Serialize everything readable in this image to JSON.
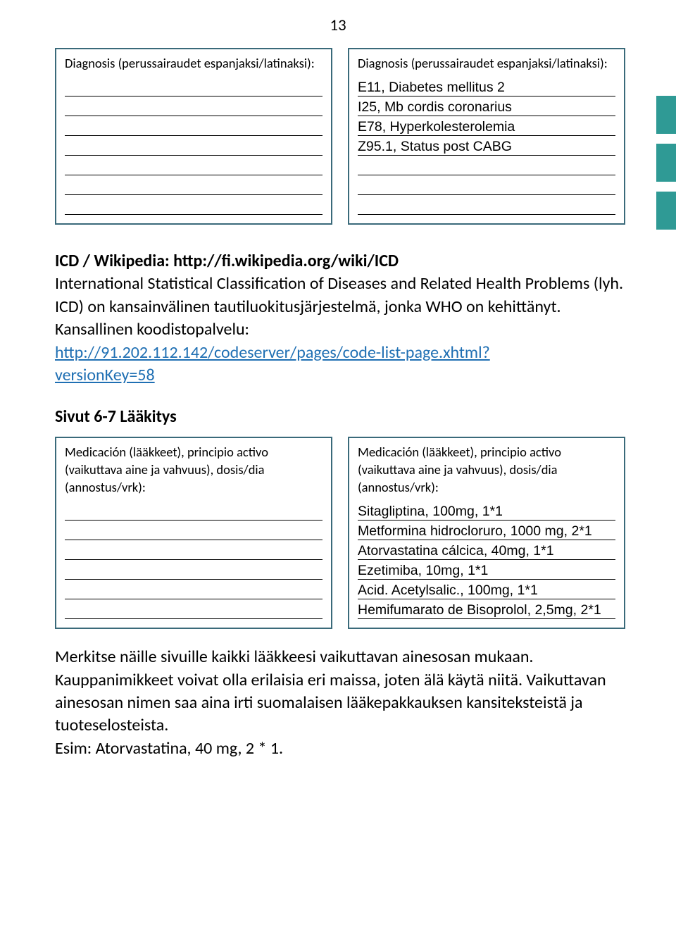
{
  "page_number": "13",
  "diag_box_left": {
    "label": "Diagnosis (perussairaudet espanjaksi/latinaksi):",
    "lines": [
      "",
      "",
      "",
      "",
      "",
      "",
      ""
    ]
  },
  "diag_box_right": {
    "label": "Diagnosis (perussairaudet espanjaksi/latinaksi):",
    "lines": [
      "E11, Diabetes mellitus 2",
      "I25, Mb cordis coronarius",
      "E78, Hyperkolesterolemia",
      "Z95.1, Status post CABG",
      "",
      "",
      ""
    ]
  },
  "icd_para": {
    "lead": "ICD / Wikipedia: http://fi.wikipedia.org/wiki/ICD",
    "text1": "International Statistical Classification of Diseases and Related Health Problems (lyh. ICD) on kansainvälinen tautiluokitusjärjestelmä, jonka WHO on kehittänyt.",
    "text2": "Kansallinen koodistopalvelu:",
    "link1": "http://91.202.112.142/codeserver/pages/code-list-page.xhtml?",
    "link2": "versionKey=58"
  },
  "section_heading": "Sivut 6-7 Lääkitys",
  "med_box_left": {
    "label": "Medicación (lääkkeet), principio activo (vaikuttava aine ja vahvuus), dosis/dia (annostus/vrk):",
    "lines": [
      "",
      "",
      "",
      "",
      "",
      ""
    ]
  },
  "med_box_right": {
    "label": "Medicación (lääkkeet), principio activo (vaikuttava aine ja vahvuus), dosis/dia (annostus/vrk):",
    "lines": [
      "Sitagliptina, 100mg, 1*1",
      "Metformina hidrocloruro, 1000 mg, 2*1",
      "Atorvastatina cálcica, 40mg, 1*1",
      "Ezetimiba, 10mg, 1*1",
      "Acid. Acetylsalic., 100mg, 1*1",
      "Hemifumarato de Bisoprolol, 2,5mg, 2*1"
    ]
  },
  "closing_para": "Merkitse näille sivuille kaikki lääkkeesi vaikuttavan ainesosan mukaan. Kauppanimikkeet voivat olla erilaisia eri maissa, joten älä käytä niitä. Vaikuttavan ainesosan nimen saa aina irti suomalaisen lääkepakkauksen kansiteksteistä ja tuoteselosteista.",
  "closing_example": "Esim: Atorvastatina, 40 mg, 2 * 1."
}
